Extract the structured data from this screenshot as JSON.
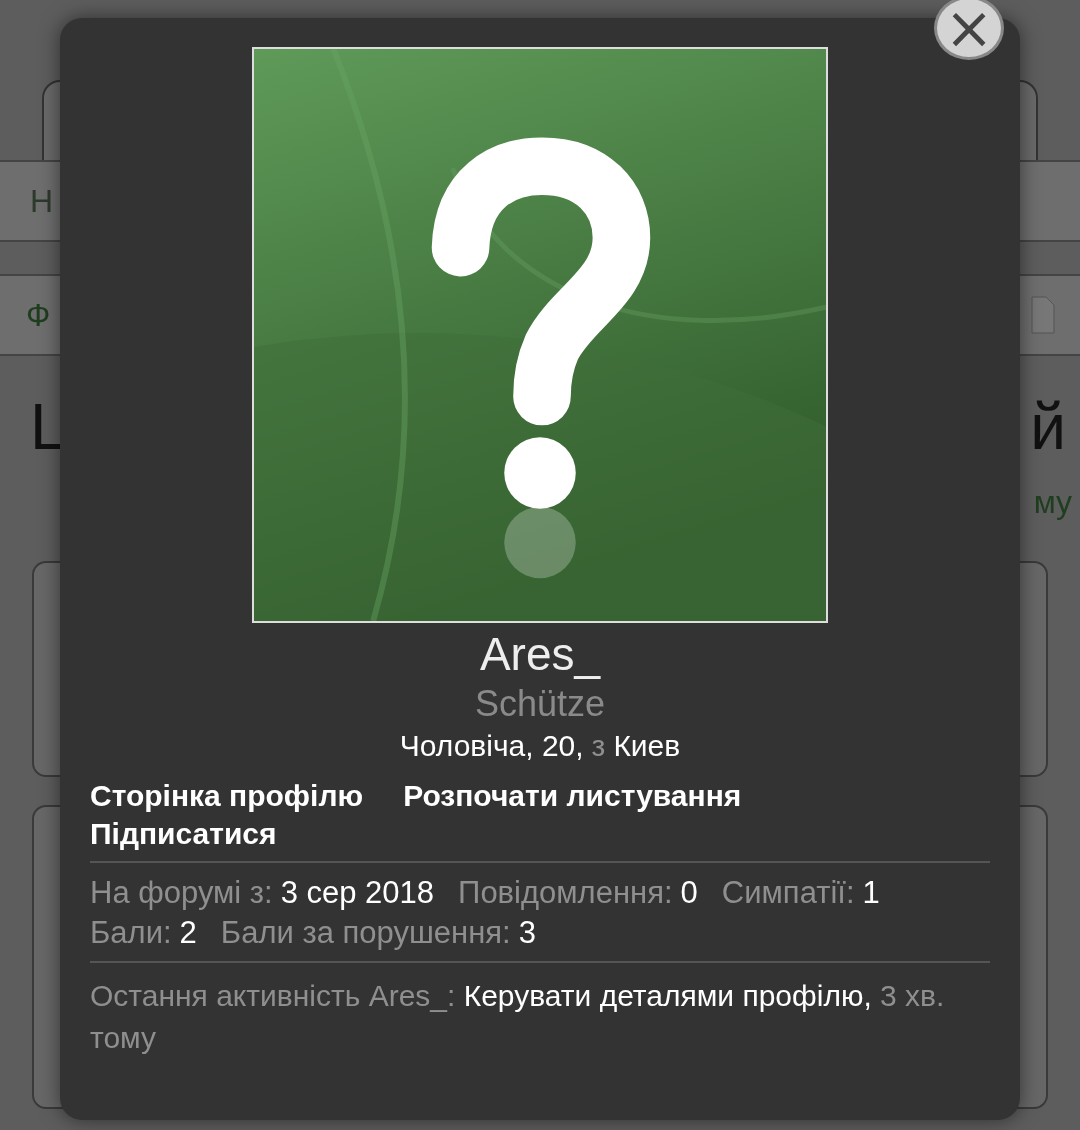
{
  "background_page": {
    "nav_fragment": "Н",
    "forum_fragment": "Ф",
    "heading_left_fragment": "L",
    "heading_right_fragment": "й",
    "subtitle_fragment": "му"
  },
  "profile_popup": {
    "close_button": "×",
    "username": "Ares_",
    "user_title": "Schütze",
    "info": {
      "gender_age": "Чоловіча, 20,",
      "connector": "з",
      "location": "Киев"
    },
    "links": [
      "Сторінка профілю",
      "Розпочати листування",
      "Підписатися"
    ],
    "stats": [
      {
        "label": "На форумі з:",
        "value": "3 сер 2018"
      },
      {
        "label": "Повідомлення:",
        "value": "0"
      },
      {
        "label": "Симпатії:",
        "value": "1"
      },
      {
        "label": "Бали:",
        "value": "2"
      },
      {
        "label": "Бали за порушення:",
        "value": "3"
      }
    ],
    "last_activity": {
      "label": "Остання активність Ares_:",
      "action": "Керувати деталями профілю,",
      "time": "3 хв. тому"
    }
  }
}
